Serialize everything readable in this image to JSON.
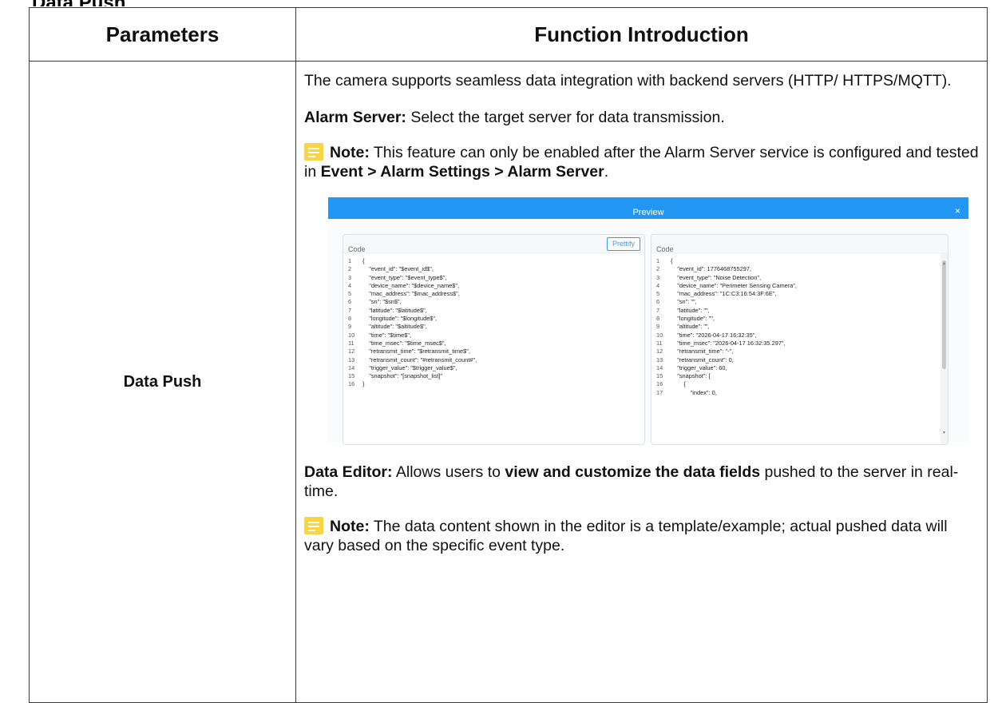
{
  "page_top_fragment": "Data Push",
  "table": {
    "header_parameters": "Parameters",
    "header_function": "Function Introduction",
    "row_parameter": "Data Push"
  },
  "intro": {
    "p1": "The camera supports seamless data integration with backend servers (HTTP/ HTTPS/MQTT).",
    "alarm_label": "Alarm Server:",
    "alarm_text": " Select the target server for data transmission.",
    "note1_label": "Note:",
    "note1_text_a": "  This feature can only be enabled after the Alarm Server service is configured and tested in ",
    "note1_path": "Event > Alarm Settings > Alarm Server",
    "note1_text_b": ".",
    "editor_label": "Data Editor:",
    "editor_text_a": " Allows users to ",
    "editor_bold": "view and customize the data fields",
    "editor_text_b": " pushed to the server in real-time.",
    "note2_label": "Note:",
    "note2_text": "  The data content shown in the editor is a template/example; actual pushed data will vary based on the specific event type."
  },
  "preview": {
    "title": "Preview",
    "close_glyph": "×",
    "left_label": "Code",
    "prettify_label": "Prettify",
    "right_label": "Code",
    "left_lines": [
      {
        "n": "1",
        "t": "{"
      },
      {
        "n": "2",
        "t": "    \"event_id\": \"$event_id$\","
      },
      {
        "n": "3",
        "t": "    \"event_type\": \"$event_type$\","
      },
      {
        "n": "4",
        "t": "    \"device_name\": \"$device_name$\","
      },
      {
        "n": "5",
        "t": "    \"mac_address\": \"$mac_address$\","
      },
      {
        "n": "6",
        "t": "    \"sn\": \"$sn$\","
      },
      {
        "n": "7",
        "t": "    \"latitude\": \"$latitude$\","
      },
      {
        "n": "8",
        "t": "    \"longitude\": \"$longitude$\","
      },
      {
        "n": "9",
        "t": "    \"altitude\": \"$altitude$\","
      },
      {
        "n": "10",
        "t": "    \"time\": \"$time$\","
      },
      {
        "n": "11",
        "t": "    \"time_msec\": \"$time_msec$\","
      },
      {
        "n": "12",
        "t": "    \"retransmit_time\": \"$retransmit_time$\","
      },
      {
        "n": "13",
        "t": "    \"retransmit_count\": \"#retransmit_count#\","
      },
      {
        "n": "14",
        "t": "    \"trigger_value\": \"$trigger_value$\","
      },
      {
        "n": "15",
        "t": "    \"snapshot\": \"[snapshot_list]\""
      },
      {
        "n": "16",
        "t": "}"
      }
    ],
    "right_lines": [
      {
        "n": "1",
        "t": "{"
      },
      {
        "n": "2",
        "t": "    \"event_id\": 1776468755297,"
      },
      {
        "n": "3",
        "t": "    \"event_type\": \"Noise Detection\","
      },
      {
        "n": "4",
        "t": "    \"device_name\": \"Perimeter Sensing Camera\","
      },
      {
        "n": "5",
        "t": "    \"mac_address\": \"1C:C3:16:54:3F:6E\","
      },
      {
        "n": "6",
        "t": "    \"sn\": \"\","
      },
      {
        "n": "7",
        "t": "    \"latitude\": \"\","
      },
      {
        "n": "8",
        "t": "    \"longitude\": \"\","
      },
      {
        "n": "9",
        "t": "    \"altitude\": \"\","
      },
      {
        "n": "10",
        "t": "    \"time\": \"2026-04-17 16:32:35\","
      },
      {
        "n": "11",
        "t": "    \"time_msec\": \"2026-04-17 16:32:35.297\","
      },
      {
        "n": "12",
        "t": "    \"retransmit_time\": \"-\","
      },
      {
        "n": "13",
        "t": "    \"retransmit_count\": 0,"
      },
      {
        "n": "14",
        "t": "    \"trigger_value\": 60,"
      },
      {
        "n": "15",
        "t": "    \"snapshot\": ["
      },
      {
        "n": "16",
        "t": "        {"
      },
      {
        "n": "17",
        "t": "            \"index\": 0,"
      }
    ]
  },
  "colors": {
    "note_icon": "#f9d445",
    "preview_bar": "#2196f3",
    "prettify_border": "#3d94f6"
  }
}
